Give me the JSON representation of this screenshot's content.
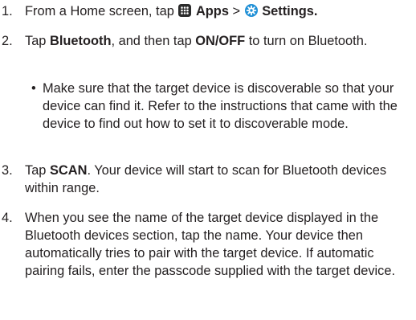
{
  "steps": [
    {
      "num": "1.",
      "parts": {
        "t1": "From a Home screen, tap ",
        "apps_label": "Apps",
        "t2": " > ",
        "settings_label": "Settings."
      },
      "icons": [
        "apps-grid-icon",
        "settings-gear-icon"
      ]
    },
    {
      "num": "2.",
      "parts": {
        "t1": "Tap ",
        "bluetooth_label": "Bluetooth",
        "t2": ", and then tap ",
        "onoff_label": "ON/OFF",
        "t3": " to turn on Bluetooth."
      },
      "bullet": {
        "mark": "•",
        "text": "Make sure that the target device is discoverable so that your device can find it. Refer to the instructions that came with the device to find out how to set it to discoverable mode."
      }
    },
    {
      "num": "3.",
      "parts": {
        "t1": "Tap ",
        "scan_label": "SCAN",
        "t2": ". Your device will start to scan for Bluetooth devices within range."
      }
    },
    {
      "num": "4.",
      "text": "When you see the name of the target device displayed in the Bluetooth devices section, tap the name. Your device then automatically tries to pair with the target device. If automatic pairing fails, enter the passcode supplied with the target device."
    }
  ],
  "colors": {
    "text": "#231f20",
    "apps_icon": "#2b2b2b",
    "settings_icon": "#1e8fd6"
  }
}
